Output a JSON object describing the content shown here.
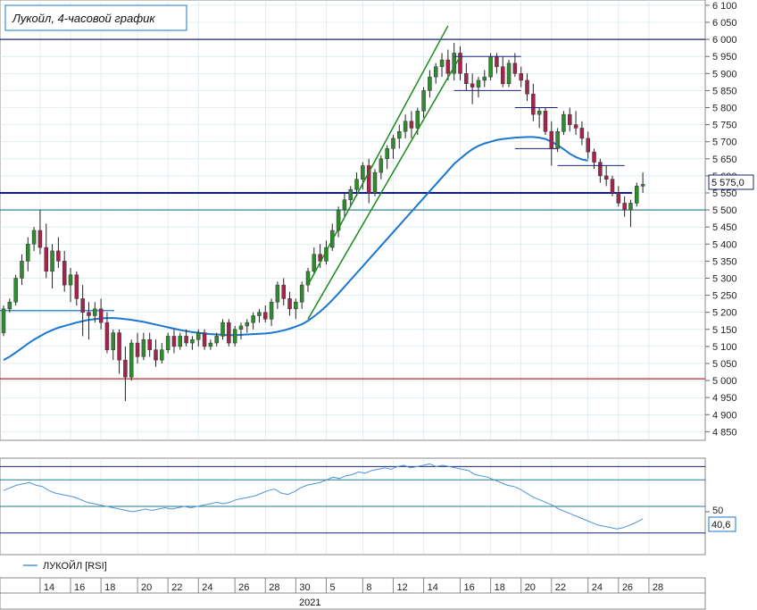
{
  "chart_data": [
    {
      "type": "candlestick",
      "title": "Лукойл, 4-часовой график",
      "y_ticks": [
        4850,
        4900,
        4950,
        5000,
        5050,
        5100,
        5150,
        5200,
        5250,
        5300,
        5350,
        5400,
        5450,
        5500,
        5550,
        5600,
        5650,
        5700,
        5750,
        5800,
        5850,
        5900,
        5950,
        6000,
        6050,
        6100
      ],
      "y_tick_labels": [
        "4 850",
        "4 900",
        "4 950",
        "5 000",
        "5 050",
        "5 100",
        "5 150",
        "5 200",
        "5 250",
        "5 300",
        "5 350",
        "5 400",
        "5 450",
        "5 500",
        "5 550",
        "5 600",
        "5 650",
        "5 700",
        "5 750",
        "5 800",
        "5 850",
        "5 900",
        "5 950",
        "6 000",
        "6 050",
        "6 100"
      ],
      "ylim": [
        4830,
        6105
      ],
      "last_price": 5575,
      "last_price_label": "5 575,0",
      "candles": [
        [
          5140,
          5220,
          5130,
          5210
        ],
        [
          5210,
          5240,
          5200,
          5230
        ],
        [
          5230,
          5310,
          5220,
          5300
        ],
        [
          5300,
          5370,
          5280,
          5350
        ],
        [
          5350,
          5420,
          5320,
          5400
        ],
        [
          5400,
          5450,
          5380,
          5440
        ],
        [
          5440,
          5500,
          5370,
          5390
        ],
        [
          5390,
          5460,
          5300,
          5320
        ],
        [
          5320,
          5400,
          5270,
          5380
        ],
        [
          5380,
          5420,
          5330,
          5350
        ],
        [
          5350,
          5380,
          5260,
          5280
        ],
        [
          5280,
          5330,
          5230,
          5310
        ],
        [
          5310,
          5320,
          5220,
          5240
        ],
        [
          5240,
          5280,
          5130,
          5200
        ],
        [
          5200,
          5230,
          5120,
          5190
        ],
        [
          5190,
          5230,
          5170,
          5210
        ],
        [
          5210,
          5240,
          5150,
          5170
        ],
        [
          5170,
          5200,
          5080,
          5090
        ],
        [
          5090,
          5150,
          5060,
          5140
        ],
        [
          5140,
          5150,
          5020,
          5060
        ],
        [
          5060,
          5100,
          4940,
          5010
        ],
        [
          5010,
          5120,
          5000,
          5110
        ],
        [
          5110,
          5140,
          5050,
          5070
        ],
        [
          5070,
          5140,
          5060,
          5120
        ],
        [
          5120,
          5140,
          5070,
          5090
        ],
        [
          5090,
          5120,
          5040,
          5060
        ],
        [
          5060,
          5110,
          5050,
          5090
        ],
        [
          5090,
          5140,
          5080,
          5130
        ],
        [
          5130,
          5150,
          5080,
          5100
        ],
        [
          5100,
          5140,
          5090,
          5130
        ],
        [
          5130,
          5150,
          5100,
          5110
        ],
        [
          5110,
          5130,
          5090,
          5120
        ],
        [
          5120,
          5150,
          5100,
          5140
        ],
        [
          5140,
          5150,
          5090,
          5100
        ],
        [
          5100,
          5120,
          5090,
          5110
        ],
        [
          5110,
          5140,
          5100,
          5130
        ],
        [
          5130,
          5180,
          5120,
          5170
        ],
        [
          5170,
          5180,
          5100,
          5110
        ],
        [
          5110,
          5160,
          5100,
          5150
        ],
        [
          5150,
          5170,
          5120,
          5160
        ],
        [
          5160,
          5180,
          5140,
          5170
        ],
        [
          5170,
          5200,
          5150,
          5190
        ],
        [
          5190,
          5210,
          5170,
          5200
        ],
        [
          5200,
          5220,
          5170,
          5180
        ],
        [
          5180,
          5240,
          5160,
          5230
        ],
        [
          5230,
          5290,
          5210,
          5280
        ],
        [
          5280,
          5300,
          5220,
          5240
        ],
        [
          5240,
          5260,
          5190,
          5210
        ],
        [
          5210,
          5240,
          5180,
          5230
        ],
        [
          5230,
          5290,
          5210,
          5280
        ],
        [
          5280,
          5330,
          5260,
          5320
        ],
        [
          5320,
          5390,
          5310,
          5370
        ],
        [
          5370,
          5400,
          5330,
          5350
        ],
        [
          5350,
          5410,
          5340,
          5390
        ],
        [
          5390,
          5460,
          5380,
          5440
        ],
        [
          5440,
          5510,
          5420,
          5500
        ],
        [
          5500,
          5550,
          5480,
          5530
        ],
        [
          5530,
          5570,
          5510,
          5560
        ],
        [
          5560,
          5610,
          5540,
          5590
        ],
        [
          5590,
          5640,
          5560,
          5630
        ],
        [
          5630,
          5650,
          5520,
          5550
        ],
        [
          5550,
          5620,
          5540,
          5610
        ],
        [
          5610,
          5660,
          5590,
          5650
        ],
        [
          5650,
          5690,
          5620,
          5680
        ],
        [
          5680,
          5720,
          5650,
          5710
        ],
        [
          5710,
          5750,
          5680,
          5730
        ],
        [
          5730,
          5780,
          5710,
          5760
        ],
        [
          5760,
          5790,
          5710,
          5740
        ],
        [
          5740,
          5800,
          5720,
          5790
        ],
        [
          5790,
          5860,
          5770,
          5850
        ],
        [
          5850,
          5910,
          5830,
          5890
        ],
        [
          5890,
          5930,
          5870,
          5920
        ],
        [
          5920,
          5960,
          5890,
          5940
        ],
        [
          5940,
          5970,
          5880,
          5900
        ],
        [
          5900,
          5990,
          5880,
          5960
        ],
        [
          5960,
          5980,
          5880,
          5900
        ],
        [
          5900,
          5930,
          5850,
          5870
        ],
        [
          5870,
          5900,
          5810,
          5860
        ],
        [
          5860,
          5890,
          5830,
          5880
        ],
        [
          5880,
          5910,
          5860,
          5890
        ],
        [
          5890,
          5960,
          5880,
          5950
        ],
        [
          5950,
          5960,
          5900,
          5920
        ],
        [
          5920,
          5950,
          5860,
          5870
        ],
        [
          5870,
          5940,
          5860,
          5930
        ],
        [
          5930,
          5960,
          5890,
          5900
        ],
        [
          5900,
          5920,
          5860,
          5880
        ],
        [
          5880,
          5900,
          5820,
          5840
        ],
        [
          5840,
          5870,
          5760,
          5780
        ],
        [
          5780,
          5800,
          5740,
          5790
        ],
        [
          5790,
          5800,
          5720,
          5730
        ],
        [
          5730,
          5760,
          5630,
          5680
        ],
        [
          5680,
          5740,
          5670,
          5730
        ],
        [
          5730,
          5790,
          5720,
          5780
        ],
        [
          5780,
          5800,
          5730,
          5750
        ],
        [
          5750,
          5790,
          5720,
          5740
        ],
        [
          5740,
          5760,
          5690,
          5710
        ],
        [
          5710,
          5730,
          5650,
          5670
        ],
        [
          5670,
          5680,
          5620,
          5640
        ],
        [
          5640,
          5650,
          5580,
          5600
        ],
        [
          5600,
          5630,
          5570,
          5590
        ],
        [
          5590,
          5600,
          5540,
          5550
        ],
        [
          5550,
          5570,
          5510,
          5520
        ],
        [
          5520,
          5540,
          5480,
          5500
        ],
        [
          5500,
          5530,
          5450,
          5520
        ],
        [
          5520,
          5580,
          5510,
          5570
        ],
        [
          5570,
          5610,
          5550,
          5575
        ]
      ],
      "sma": [
        5060,
        5070,
        5082,
        5095,
        5108,
        5120,
        5130,
        5140,
        5148,
        5155,
        5160,
        5165,
        5170,
        5174,
        5178,
        5180,
        5182,
        5183,
        5183,
        5182,
        5180,
        5178,
        5175,
        5172,
        5168,
        5164,
        5160,
        5156,
        5152,
        5148,
        5145,
        5142,
        5140,
        5138,
        5136,
        5135,
        5134,
        5133,
        5133,
        5134,
        5135,
        5136,
        5137,
        5138,
        5140,
        5143,
        5147,
        5152,
        5158,
        5165,
        5175,
        5188,
        5202,
        5218,
        5236,
        5255,
        5275,
        5295,
        5315,
        5335,
        5355,
        5375,
        5395,
        5415,
        5435,
        5455,
        5475,
        5495,
        5515,
        5535,
        5555,
        5575,
        5595,
        5615,
        5635,
        5650,
        5665,
        5678,
        5688,
        5695,
        5700,
        5705,
        5708,
        5710,
        5712,
        5713,
        5714,
        5714,
        5712,
        5708,
        5700,
        5690,
        5678,
        5665,
        5655,
        5648,
        5645
      ],
      "horizontal_levels": [
        {
          "value": 6000,
          "color": "#1a237e"
        },
        {
          "value": 5500,
          "color": "#1e7a8c"
        },
        {
          "value": 5005,
          "color": "#c0262c"
        },
        {
          "value": 5205,
          "color": "#1976d2",
          "partial": true
        },
        {
          "value": 5550,
          "color": "#0d1aa8",
          "thick": true
        }
      ],
      "channel_lines": [
        {
          "from": [
            50,
            5280
          ],
          "to": [
            73,
            6040
          ]
        },
        {
          "from": [
            50,
            5180
          ],
          "to": [
            75,
            5950
          ]
        }
      ],
      "resistance_segments": [
        {
          "from": [
            74,
            5950
          ],
          "to": [
            85,
            5950
          ]
        },
        {
          "from": [
            74,
            5850
          ],
          "to": [
            85,
            5850
          ]
        },
        {
          "from": [
            84,
            5800
          ],
          "to": [
            91,
            5800
          ]
        },
        {
          "from": [
            84,
            5680
          ],
          "to": [
            91,
            5680
          ]
        },
        {
          "from": [
            91,
            5630
          ],
          "to": [
            102,
            5630
          ]
        }
      ],
      "rsi": {
        "label": "ЛУКОЙЛ [RSI]",
        "last_label": "40,6",
        "tick_labels": [
          "50"
        ],
        "ylim": [
          15,
          85
        ],
        "levels": [
          80,
          70,
          50,
          30
        ],
        "values": [
          62,
          64,
          66,
          67,
          68,
          66,
          65,
          62,
          60,
          59,
          58,
          57,
          55,
          53,
          52,
          51,
          50,
          49,
          48,
          47,
          46,
          47,
          48,
          47,
          48,
          49,
          48,
          49,
          50,
          49,
          50,
          51,
          52,
          53,
          52,
          53,
          55,
          56,
          57,
          58,
          60,
          62,
          63,
          60,
          59,
          61,
          64,
          66,
          67,
          68,
          70,
          72,
          71,
          73,
          74,
          76,
          75,
          77,
          78,
          79,
          78,
          80,
          81,
          79,
          80,
          81,
          82,
          80,
          81,
          80,
          79,
          78,
          77,
          74,
          73,
          72,
          70,
          68,
          66,
          65,
          63,
          60,
          57,
          55,
          53,
          51,
          48,
          46,
          44,
          42,
          40,
          38,
          36,
          35,
          34,
          33,
          34,
          36,
          38,
          40.6
        ]
      },
      "x_tick_labels": [
        "14",
        "16",
        "18",
        "20",
        "22",
        "24",
        "26",
        "28",
        "30",
        "5",
        "8",
        "12",
        "14",
        "16",
        "18",
        "20",
        "22",
        "24",
        "26",
        "28"
      ],
      "x_tick_positions": [
        6,
        11,
        16,
        22,
        27,
        32,
        38,
        43,
        48,
        53,
        59,
        64,
        69,
        75,
        80,
        85,
        90,
        96,
        101,
        106
      ],
      "month_label": "2021"
    }
  ],
  "colors": {
    "up_candle": "#2e8b2e",
    "down_candle": "#a3254b",
    "sma": "#1976d2",
    "rsi_line": "#4d93d8",
    "channel": "#1a8c1a",
    "grid": "#cfe3ea",
    "title_border": "#1976d2"
  }
}
